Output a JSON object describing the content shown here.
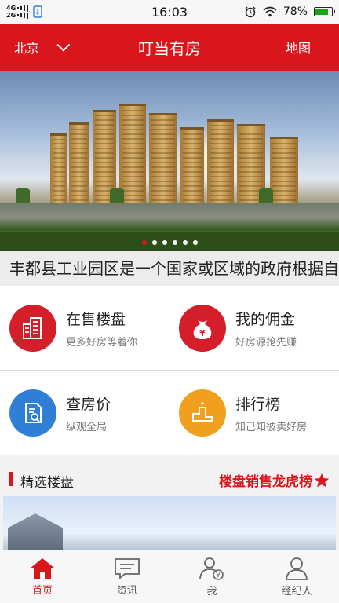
{
  "status_bar": {
    "network_1": "4G",
    "network_2": "2G",
    "time": "16:03",
    "battery": "78%",
    "battery_level": 0.78
  },
  "header": {
    "city": "北京",
    "title": "叮当有房",
    "map_label": "地图"
  },
  "banner": {
    "slide_count": 6,
    "active_slide": 1
  },
  "ticker": {
    "text": "丰都县工业园区是一个国家或区域的政府根据自"
  },
  "features": [
    {
      "title": "在售楼盘",
      "subtitle": "更多好房等着你",
      "icon": "buildings-icon",
      "color": "#d41f2a"
    },
    {
      "title": "我的佣金",
      "subtitle": "好房源抢先赚",
      "icon": "money-bag-icon",
      "color": "#d41f2a"
    },
    {
      "title": "查房价",
      "subtitle": "纵观全局",
      "icon": "document-search-icon",
      "color": "#2f7fd6"
    },
    {
      "title": "排行榜",
      "subtitle": "知己知彼卖好房",
      "icon": "podium-icon",
      "color": "#f0a01e"
    }
  ],
  "section": {
    "title": "精选楼盘",
    "link": "楼盘销售龙虎榜"
  },
  "tabs": [
    {
      "label": "首页",
      "icon": "home-icon",
      "active": true
    },
    {
      "label": "资讯",
      "icon": "news-icon",
      "active": false
    },
    {
      "label": "我",
      "icon": "user-commission-icon",
      "active": false
    },
    {
      "label": "经纪人",
      "icon": "agent-icon",
      "active": false
    }
  ],
  "colors": {
    "brand": "#d9161c"
  }
}
